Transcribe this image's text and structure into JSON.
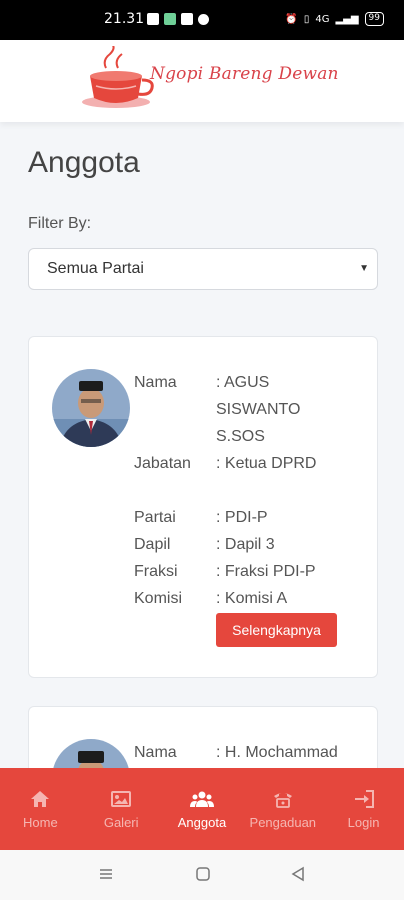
{
  "status_bar": {
    "time": "21.31",
    "battery": "99",
    "network": "4G"
  },
  "header": {
    "logo_text": "Ngopi Bareng Dewan"
  },
  "page": {
    "title": "Anggota",
    "filter_label": "Filter By:",
    "filter_selected": "Semua Partai"
  },
  "members": [
    {
      "nama_key": "Nama",
      "nama_val": ": AGUS SISWANTO S.SOS",
      "jabatan_key": "Jabatan",
      "jabatan_val": ": Ketua DPRD",
      "partai_key": "Partai",
      "partai_val": ": PDI-P",
      "dapil_key": "Dapil",
      "dapil_val": ": Dapil 3",
      "fraksi_key": "Fraksi",
      "fraksi_val": ": Fraksi PDI-P",
      "komisi_key": "Komisi",
      "komisi_val": ": Komisi A",
      "button": "Selengkapnya"
    },
    {
      "nama_key": "Nama",
      "nama_val": ": H. Mochammad"
    }
  ],
  "bottom_nav": {
    "home": "Home",
    "galeri": "Galeri",
    "anggota": "Anggota",
    "pengaduan": "Pengaduan",
    "login": "Login"
  },
  "colors": {
    "accent": "#e5473d",
    "background": "#f4f6f9"
  }
}
